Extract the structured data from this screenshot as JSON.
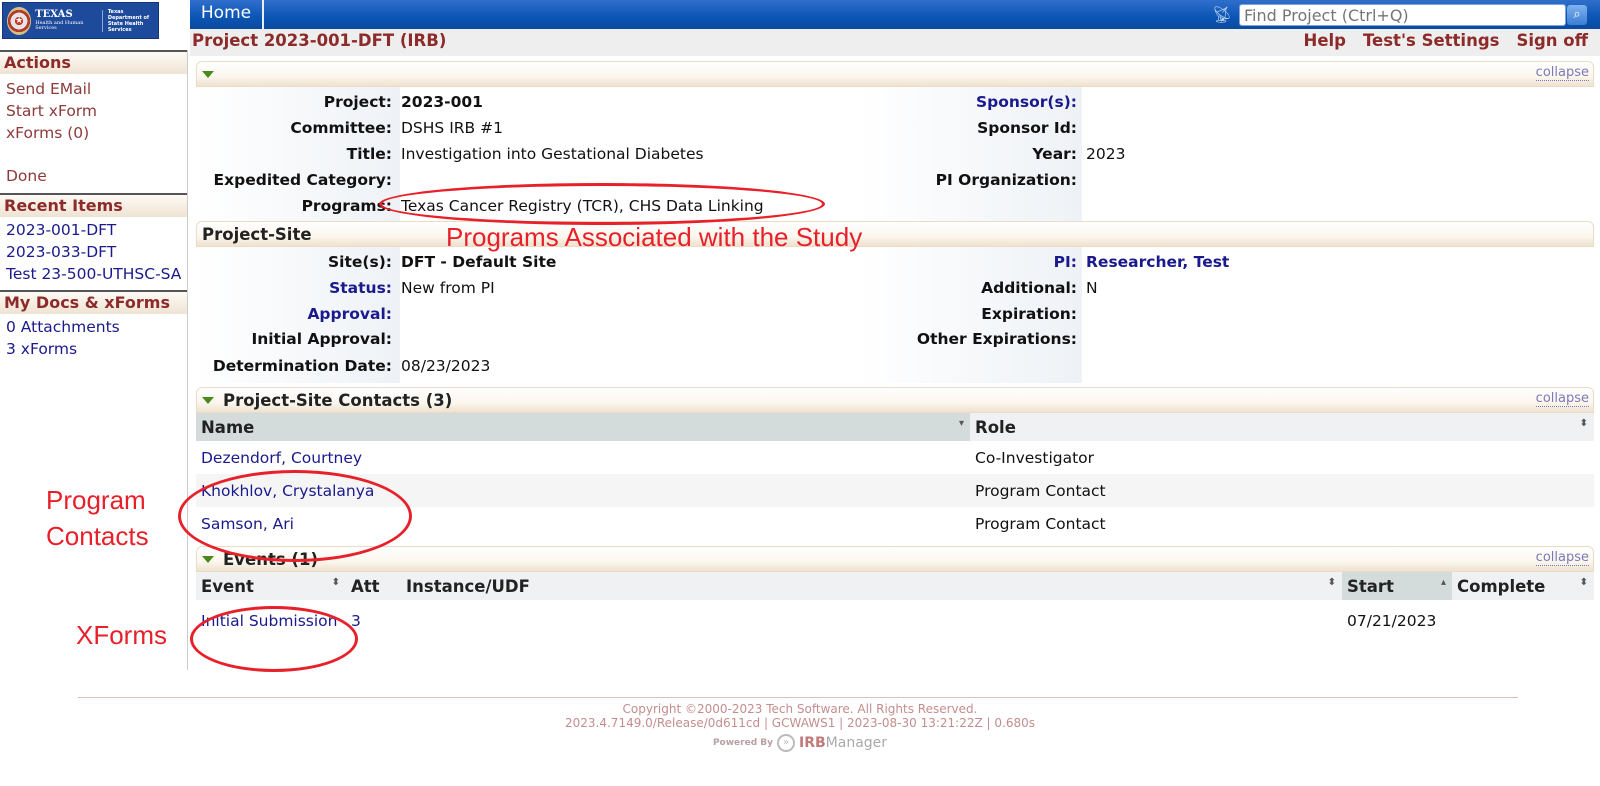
{
  "header": {
    "logo_text": "TEXAS",
    "logo_sub": "Health and Human Services",
    "logo_dept": "Texas Department of State Health Services",
    "home_tab": "Home",
    "search_placeholder": "Find Project (Ctrl+Q)",
    "page_title": "Project 2023-001-DFT (IRB)",
    "links": [
      "Help",
      "Test's Settings",
      "Sign off"
    ]
  },
  "sidebar": {
    "actions_title": "Actions",
    "actions": [
      "Send EMail",
      "Start xForm",
      "xForms (0)",
      "Done"
    ],
    "recent_title": "Recent Items",
    "recent": [
      "2023-001-DFT",
      "2023-033-DFT",
      "Test 23-500-UTHSC-SA"
    ],
    "docs_title": "My Docs & xForms",
    "docs": [
      "0 Attachments",
      "3 xForms"
    ]
  },
  "project": {
    "collapse": "collapse",
    "left": [
      {
        "label": "Project:",
        "value": "2023-001"
      },
      {
        "label": "Committee:",
        "value": "DSHS IRB #1"
      },
      {
        "label": "Title:",
        "value": "Investigation into Gestational Diabetes"
      },
      {
        "label": "Expedited Category:",
        "value": ""
      },
      {
        "label": "Programs:",
        "value": "Texas Cancer Registry (TCR), CHS Data Linking"
      }
    ],
    "right": [
      {
        "label": "Sponsor(s):",
        "value": ""
      },
      {
        "label": "Sponsor Id:",
        "value": ""
      },
      {
        "label": "Year:",
        "value": "2023"
      },
      {
        "label": "PI Organization:",
        "value": ""
      }
    ]
  },
  "project_site": {
    "title": "Project-Site",
    "left": [
      {
        "label": "Site(s):",
        "value": "DFT - Default Site"
      },
      {
        "label": "Status:",
        "value": "New from PI"
      },
      {
        "label": "Approval:",
        "value": ""
      },
      {
        "label": "Initial Approval:",
        "value": ""
      },
      {
        "label": "Determination Date:",
        "value": "08/23/2023"
      }
    ],
    "right": [
      {
        "label": "PI:",
        "value": "Researcher, Test"
      },
      {
        "label": "Additional:",
        "value": "N"
      },
      {
        "label": "Expiration:",
        "value": ""
      },
      {
        "label": "Other Expirations:",
        "value": ""
      }
    ]
  },
  "contacts": {
    "title": "Project-Site Contacts (3)",
    "collapse": "collapse",
    "columns": [
      "Name",
      "Role"
    ],
    "rows": [
      {
        "name": "Dezendorf, Courtney",
        "role": "Co-Investigator"
      },
      {
        "name": "Khokhlov, Crystalanya",
        "role": "Program Contact"
      },
      {
        "name": "Samson, Ari",
        "role": "Program Contact"
      }
    ]
  },
  "events": {
    "title": "Events (1)",
    "collapse": "collapse",
    "columns": [
      "Event",
      "Att",
      "Instance/UDF",
      "Start",
      "Complete"
    ],
    "rows": [
      {
        "event": "Initial Submission",
        "att": "3",
        "instance": "",
        "start": "07/21/2023",
        "complete": ""
      }
    ]
  },
  "annotations": {
    "programs": "Programs Associated with the Study",
    "contacts_line1": "Program",
    "contacts_line2": "Contacts",
    "xforms": "XForms",
    "color": "#e8202a"
  },
  "footer": {
    "copyright": "Copyright ©2000-2023 Tech Software. All Rights Reserved.",
    "build": "2023.4.7149.0/Release/0d611cd | GCWAWS1 | 2023-08-30 13:21:22Z | 0.680s",
    "powered_by": "Powered By",
    "brand_a": "IRB",
    "brand_b": "Manager"
  }
}
